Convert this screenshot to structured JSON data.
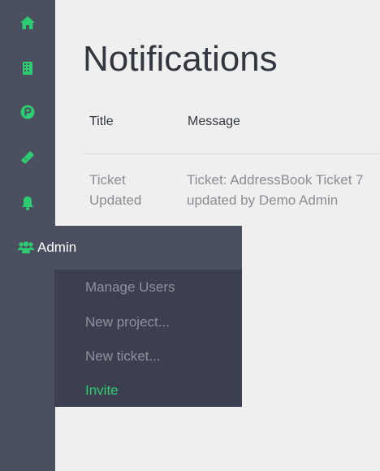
{
  "colors": {
    "accent": "#2ecc71",
    "sidebar": "#4b5061",
    "submenu": "#3c3f4f",
    "background": "#efefef"
  },
  "sidebar": {
    "icons": [
      "home-icon",
      "building-icon",
      "parking-icon",
      "ticket-icon",
      "bell-icon"
    ],
    "admin": {
      "label": "Admin",
      "icon": "users-icon",
      "submenu": [
        {
          "label": "Manage Users"
        },
        {
          "label": "New project..."
        },
        {
          "label": "New ticket..."
        },
        {
          "label": "Invite"
        }
      ]
    }
  },
  "page": {
    "title": "Notifications"
  },
  "table": {
    "headers": [
      "Title",
      "Message"
    ],
    "rows": [
      {
        "title": "Ticket Updated",
        "message": "Ticket: AddressBook Ticket 7 updated by Demo Admin"
      }
    ]
  }
}
